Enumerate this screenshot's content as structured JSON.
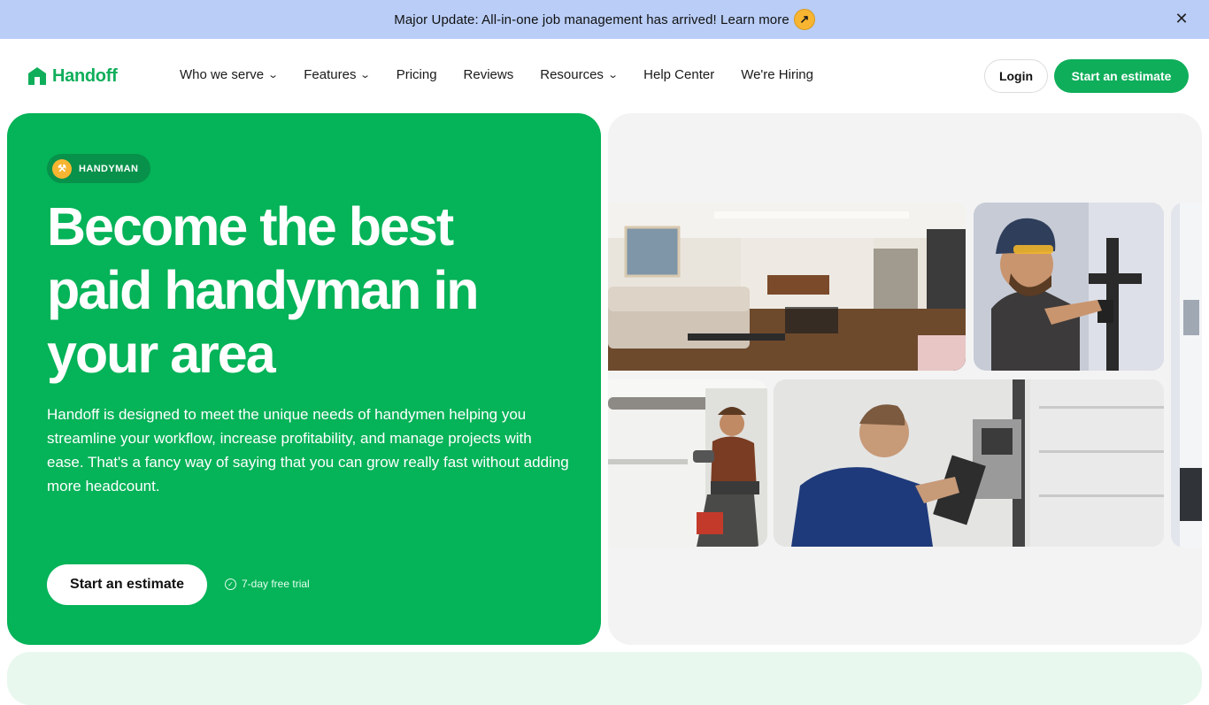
{
  "announcement": {
    "text": "Major Update: All-in-one job management has arrived! Learn more",
    "arrow_icon": "arrow-up-right-icon",
    "close_icon": "close-icon"
  },
  "brand": {
    "name": "Handoff",
    "color": "#0fae5a"
  },
  "nav": {
    "items": [
      {
        "label": "Who we serve",
        "dropdown": true
      },
      {
        "label": "Features",
        "dropdown": true
      },
      {
        "label": "Pricing",
        "dropdown": false
      },
      {
        "label": "Reviews",
        "dropdown": false
      },
      {
        "label": "Resources",
        "dropdown": true
      },
      {
        "label": "Help Center",
        "dropdown": false
      },
      {
        "label": "We're Hiring",
        "dropdown": false
      }
    ],
    "login_label": "Login",
    "estimate_label": "Start an estimate"
  },
  "hero": {
    "badge_label": "HANDYMAN",
    "title_lines": [
      "Become the best",
      "paid handyman in",
      "your area"
    ],
    "description": "Handoff is designed to meet the unique needs of handymen helping you streamline your workflow, increase profitability, and manage projects with ease.  That's a fancy way of saying that you can grow really fast without adding more headcount.",
    "cta_label": "Start an estimate",
    "trial_label": "7-day free trial",
    "accent_color": "#05b358"
  },
  "gallery": {
    "photos": [
      {
        "name": "living-room-photo"
      },
      {
        "name": "plumber-photo"
      },
      {
        "name": "kitchen-repair-photo"
      },
      {
        "name": "technician-clipboard-photo"
      },
      {
        "name": "partial-photo"
      }
    ]
  }
}
